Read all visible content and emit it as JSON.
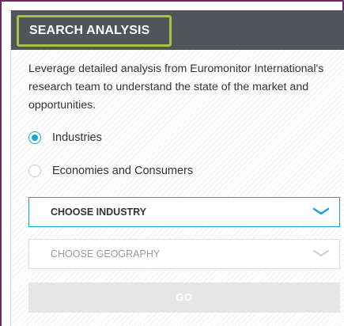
{
  "panel": {
    "title": "SEARCH ANALYSIS",
    "description": "Leverage detailed analysis from Euromonitor International's research team to understand the state of the market and opportunities.",
    "options": [
      {
        "label": "Industries",
        "selected": true
      },
      {
        "label": "Economies and Consumers",
        "selected": false
      }
    ],
    "industry_select": {
      "label": "CHOOSE INDUSTRY",
      "state": "active"
    },
    "geography_select": {
      "label": "CHOOSE GEOGRAPHY",
      "state": "disabled"
    },
    "go_label": "GO"
  },
  "colors": {
    "header_bg": "#515459",
    "highlight": "#a9c23f",
    "accent": "#13a5d6",
    "frame": "#6b2a5f"
  }
}
